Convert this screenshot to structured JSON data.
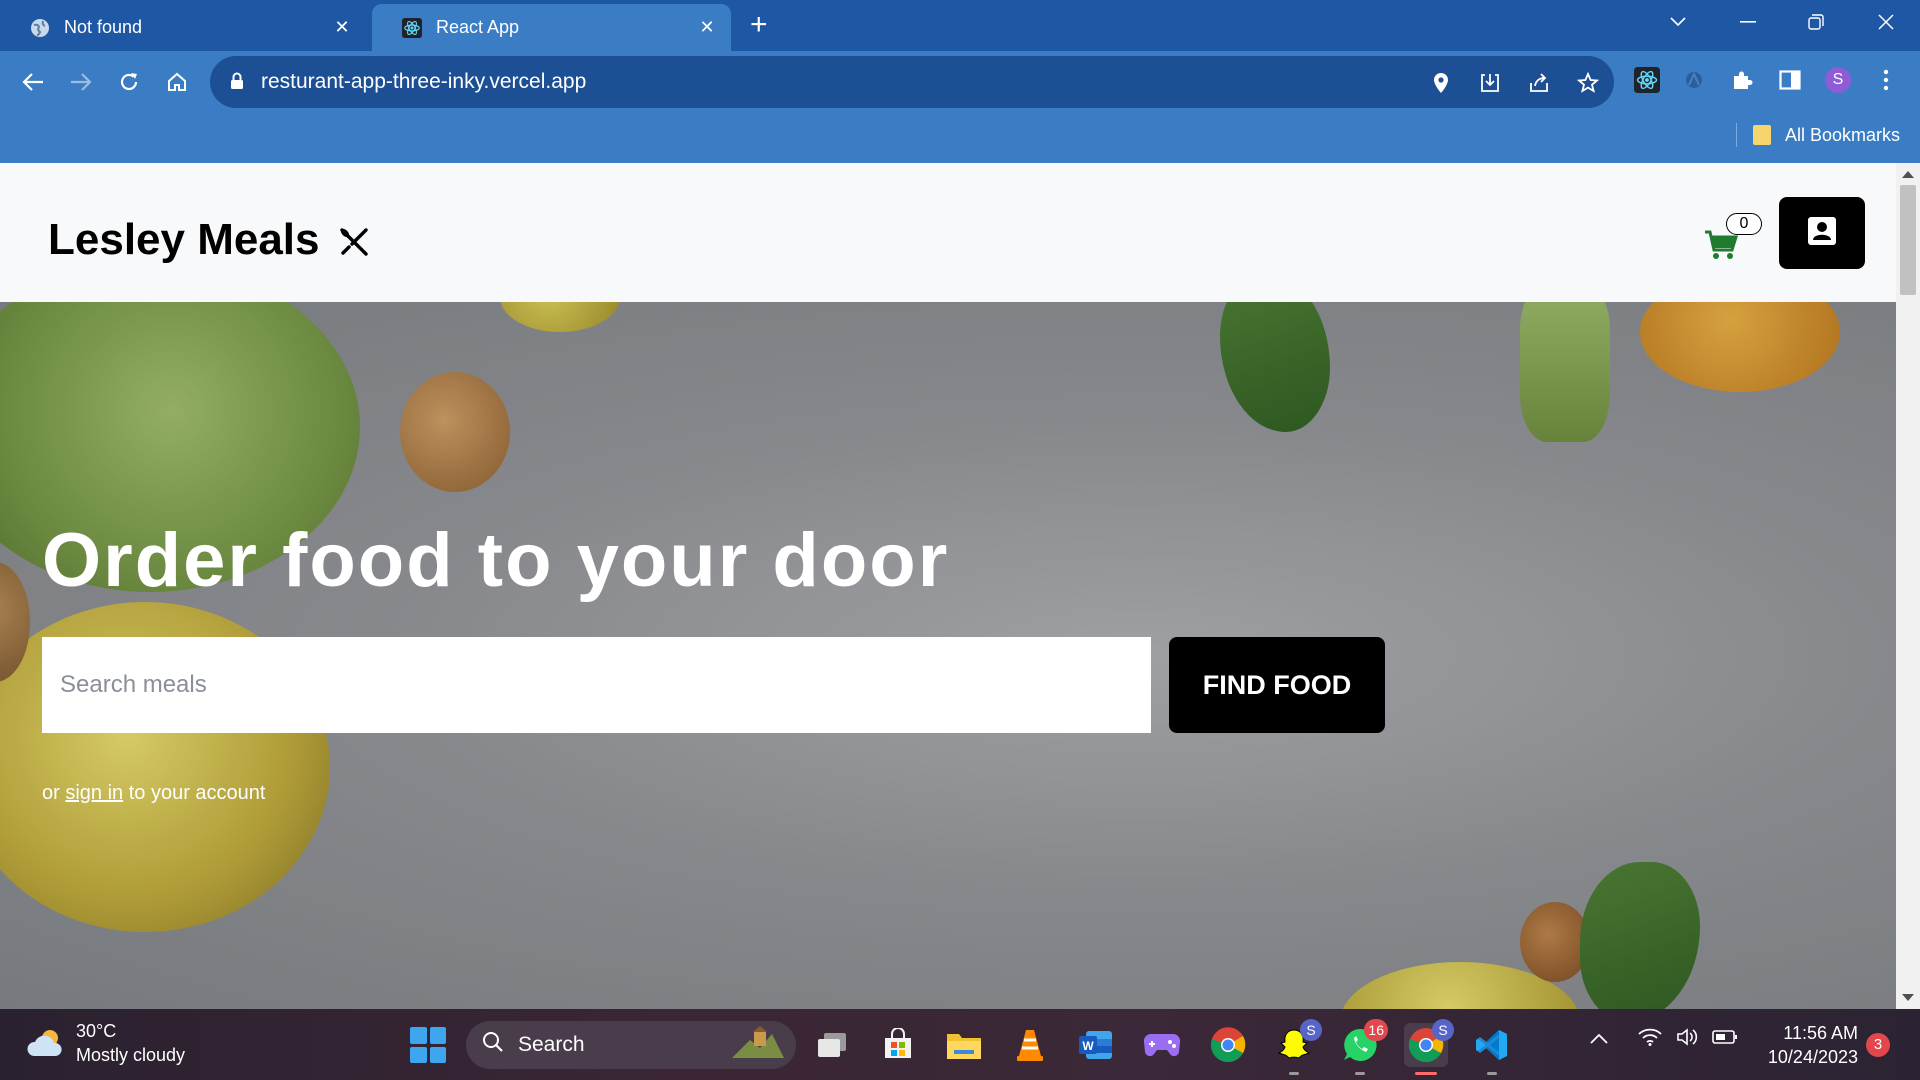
{
  "browser": {
    "tabs": [
      {
        "title": "Not found",
        "active": false
      },
      {
        "title": "React App",
        "active": true
      }
    ],
    "url": "resturant-app-three-inky.vercel.app",
    "profile_initial": "S",
    "bookmarks_label": "All Bookmarks"
  },
  "site": {
    "brand": "Lesley Meals",
    "cart_count": "0",
    "hero": {
      "headline": "Order food to your door",
      "search_placeholder": "Search meals",
      "find_button": "FIND FOOD",
      "signin_prefix": "or",
      "signin_link": "sign in",
      "signin_suffix": "to your account"
    }
  },
  "taskbar": {
    "weather_temp": "30°C",
    "weather_desc": "Mostly cloudy",
    "search_label": "Search",
    "snapchat_badge": "S",
    "whatsapp_badge": "16",
    "chrome_badge": "S",
    "time": "11:56 AM",
    "date": "10/24/2023",
    "notifications": "3"
  },
  "colors": {
    "tabstrip": "#1e58a5",
    "toolbar": "#3a7dc4",
    "cart_green": "#1e7b2f",
    "button_black": "#000000"
  }
}
